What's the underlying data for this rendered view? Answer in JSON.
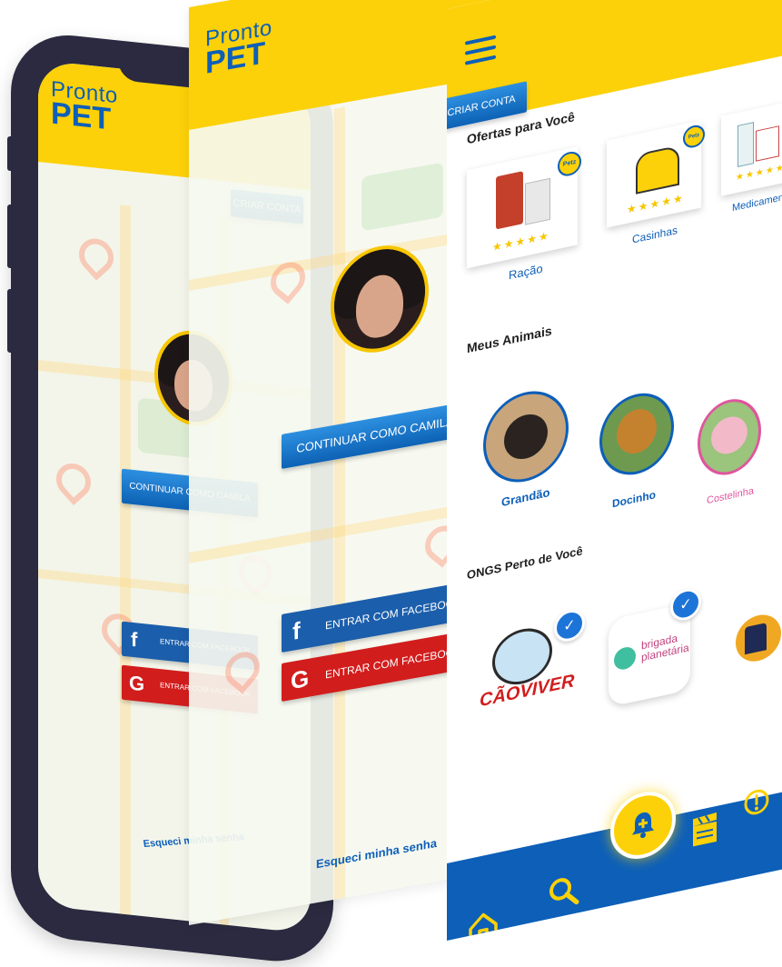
{
  "brand": {
    "logo_line1": "Pronto",
    "logo_line2": "PET"
  },
  "login": {
    "create_account": "CRIAR CONTA",
    "continue_as": "CONTINUAR COMO CAMILA",
    "facebook": "ENTRAR COM FACEBOOK",
    "google": "ENTRAR COM FACEBOOK",
    "forgot": "Esqueci minha senha"
  },
  "app": {
    "offers_title": "Ofertas para Você",
    "offers": [
      {
        "label": "Ração",
        "badge": "Petz",
        "stars": "★★★★★"
      },
      {
        "label": "Casinhas",
        "badge": "Petz",
        "stars": "★★★★★"
      },
      {
        "label": "Medicamentos",
        "stars": "★★★★★"
      }
    ],
    "animals_title": "Meus Animais",
    "animals": [
      {
        "name": "Grandão",
        "color": "#0d5fb8"
      },
      {
        "name": "Docinho",
        "color": "#0d5fb8"
      },
      {
        "name": "Costelinha",
        "color": "#e0559e"
      }
    ],
    "ongs_title": "ONGS Perto de Você",
    "ongs": [
      {
        "name": "CÃOVIVER"
      },
      {
        "name_line1": "brigada",
        "name_line2": "planetária"
      }
    ],
    "nav_icons": [
      "home-icon",
      "search-icon",
      "bell-plus-icon",
      "clapperboard-icon",
      "alert-icon"
    ]
  },
  "colors": {
    "yellow": "#fcd109",
    "blue": "#0d5fb8",
    "red": "#d21d1d",
    "phone": "#2b2a40"
  }
}
